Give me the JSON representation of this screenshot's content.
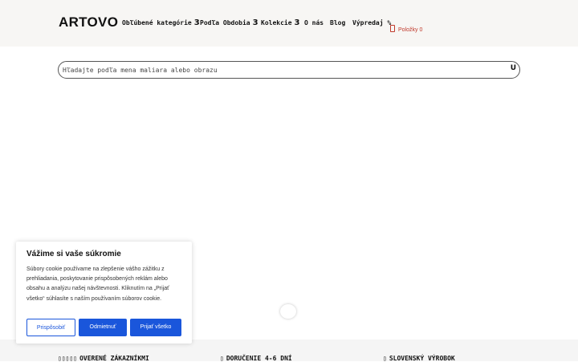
{
  "header": {
    "logo": "ARTOVO",
    "nav": [
      {
        "label": "Obľúbené kategórie",
        "chevron": "3"
      },
      {
        "label": "Podľa Obdobia",
        "chevron": "3"
      },
      {
        "label": "Kolekcie",
        "chevron": "3"
      },
      {
        "label": "O nás",
        "chevron": ""
      },
      {
        "label": "Blog",
        "chevron": ""
      },
      {
        "label": "Výpredaj %",
        "chevron": ""
      }
    ],
    "cart": {
      "label": "Položky 0",
      "icon": "shopping-bag-icon"
    }
  },
  "search": {
    "placeholder": "Hľadajte podľa mena maliara alebo obrazu",
    "icon_glyph": "U",
    "icon": "search-icon"
  },
  "cookie_banner": {
    "title": "Vážime si vaše súkromie",
    "text": "Súbory cookie používame na zlepšenie vášho zážitku z prehliadania, poskytovanie prispôsobených reklám alebo obsahu a analýzu našej návštevnosti. Kliknutím na „Prijať všetko“ súhlasíte s naším používaním súborov cookie.",
    "buttons": {
      "customize": "Prispôsobiť",
      "reject": "Odmietnuť",
      "accept": "Prijať všetko"
    }
  },
  "trust_bar": [
    {
      "icon_glyph": "▯▯▯▯▯",
      "icon": "stars-icon",
      "label": "OVERENÉ ZÁKAZNÍKMI"
    },
    {
      "icon_glyph": "▯",
      "icon": "delivery-icon",
      "label": "DORUČENIE 4-6 DNÍ"
    },
    {
      "icon_glyph": "▯",
      "icon": "flag-icon",
      "label": "SLOVENSKÝ VÝROBOK"
    }
  ],
  "colors": {
    "accent": "#1a56db",
    "cart": "#c0392b",
    "header_bg": "#f7f6f4"
  }
}
